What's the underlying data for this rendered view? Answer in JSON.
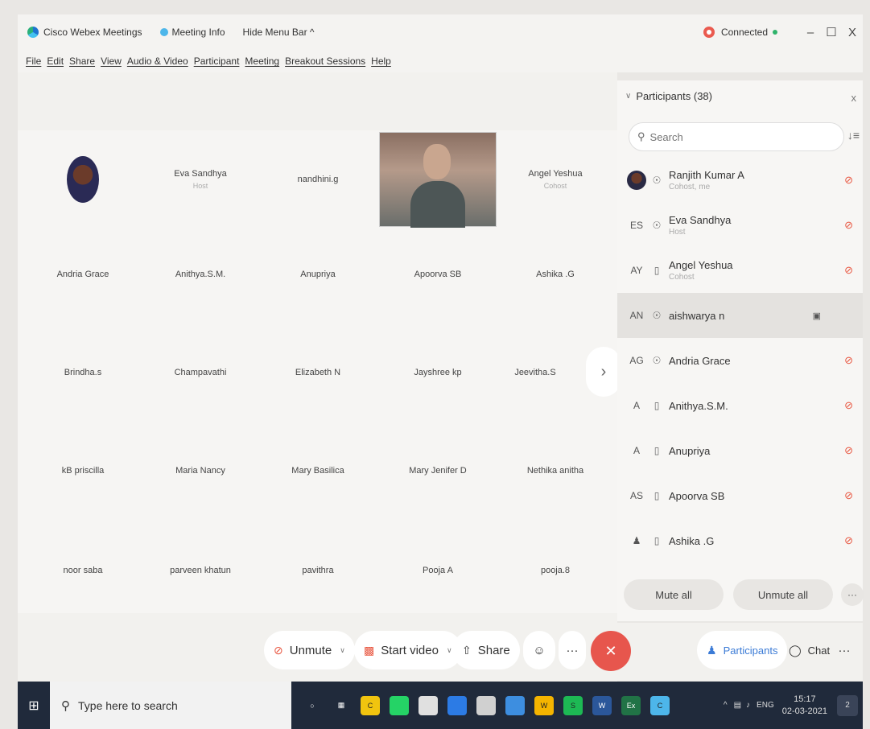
{
  "titlebar": {
    "app_title": "Cisco Webex Meetings",
    "meeting_info": "Meeting Info",
    "hide_menu": "Hide Menu Bar ^",
    "status": "Connected",
    "minimize": "–",
    "maximize": "☐",
    "close": "X"
  },
  "menu": [
    "File",
    "Edit",
    "Share",
    "View",
    "Audio & Video",
    "Participant",
    "Meeting",
    "Breakout Sessions",
    "Help"
  ],
  "grid": {
    "row1": [
      {
        "name": "",
        "sub": ""
      },
      {
        "name": "Eva Sandhya",
        "sub": "Host"
      },
      {
        "name": "nandhini.g",
        "sub": ""
      },
      {
        "name": "",
        "sub": ""
      },
      {
        "name": "Angel Yeshua",
        "sub": "Cohost"
      }
    ],
    "row2": [
      "Andria Grace",
      "Anithya.S.M.",
      "Anupriya",
      "Apoorva SB",
      "Ashika .G"
    ],
    "row3": [
      "Brindha.s",
      "Champavathi",
      "Elizabeth N",
      "Jayshree kp",
      "Jeevitha.S"
    ],
    "row4": [
      "kB priscilla",
      "Maria Nancy",
      "Mary Basilica",
      "Mary Jenifer D",
      "Nethika anitha"
    ],
    "row5": [
      "noor saba",
      "parveen khatun",
      "pavithra",
      "Pooja A",
      "pooja.8"
    ],
    "next_arrow": "›"
  },
  "panel": {
    "title": "Participants (38)",
    "close": "x",
    "search_placeholder": "Search",
    "participants": [
      {
        "initials": "",
        "name": "Ranjith Kumar A",
        "role": "Cohost, me",
        "device": "mic"
      },
      {
        "initials": "ES",
        "name": "Eva Sandhya",
        "role": "Host",
        "device": "mic"
      },
      {
        "initials": "AY",
        "name": "Angel Yeshua",
        "role": "Cohost",
        "device": "phone"
      },
      {
        "initials": "AN",
        "name": "aishwarya n",
        "role": "",
        "device": "mic"
      },
      {
        "initials": "AG",
        "name": "Andria Grace",
        "role": "",
        "device": "mic"
      },
      {
        "initials": "A",
        "name": "Anithya.S.M.",
        "role": "",
        "device": "phone"
      },
      {
        "initials": "A",
        "name": "Anupriya",
        "role": "",
        "device": "phone"
      },
      {
        "initials": "AS",
        "name": "Apoorva SB",
        "role": "",
        "device": "phone"
      },
      {
        "initials": "",
        "name": "Ashika .G",
        "role": "",
        "device": "phone"
      }
    ],
    "mute_all": "Mute all",
    "unmute_all": "Unmute all",
    "more": "···"
  },
  "toolbar": {
    "unmute": "Unmute",
    "start_video": "Start video",
    "share": "Share",
    "more": "···",
    "participants": "Participants",
    "chat": "Chat",
    "overflow": "···"
  },
  "taskbar": {
    "search_placeholder": "Type here to search",
    "lang": "ENG",
    "time": "15:17",
    "date": "02-03-2021",
    "notif_count": "2",
    "apps": [
      {
        "label": "C",
        "color": "#f1c40f"
      },
      {
        "label": "",
        "color": "#25d366"
      },
      {
        "label": "",
        "color": "#e0e0e0"
      },
      {
        "label": "",
        "color": "#2c7be5"
      },
      {
        "label": "",
        "color": "#d0d0d0"
      },
      {
        "label": "",
        "color": "#3d8ee0"
      },
      {
        "label": "W",
        "color": "#f4b400"
      },
      {
        "label": "S",
        "color": "#1db954"
      },
      {
        "label": "W",
        "color": "#2b579a"
      },
      {
        "label": "Ex",
        "color": "#217346"
      },
      {
        "label": "C",
        "color": "#4db6ea"
      }
    ]
  }
}
